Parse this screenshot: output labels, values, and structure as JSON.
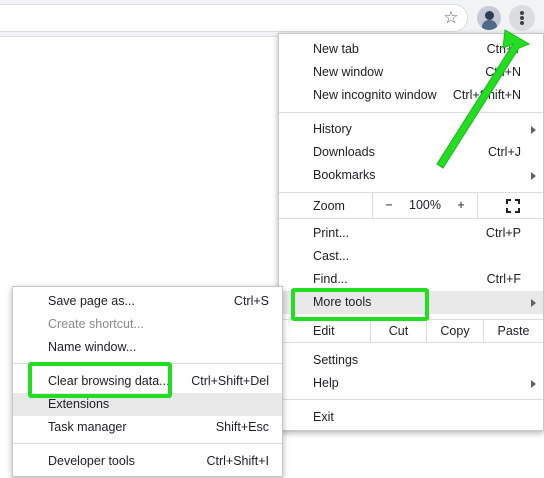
{
  "toolbar": {
    "star_icon": "star-icon",
    "avatar_icon": "avatar",
    "menu_icon": "three-dots-icon"
  },
  "main_menu": {
    "new_tab": {
      "label": "New tab",
      "shortcut": "Ctrl+T"
    },
    "new_window": {
      "label": "New window",
      "shortcut": "Ctrl+N"
    },
    "new_incognito": {
      "label": "New incognito window",
      "shortcut": "Ctrl+Shift+N"
    },
    "history": {
      "label": "History"
    },
    "downloads": {
      "label": "Downloads",
      "shortcut": "Ctrl+J"
    },
    "bookmarks": {
      "label": "Bookmarks"
    },
    "zoom": {
      "label": "Zoom",
      "minus": "−",
      "value": "100%",
      "plus": "+",
      "fullscreen_icon": "fullscreen-icon"
    },
    "print": {
      "label": "Print...",
      "shortcut": "Ctrl+P"
    },
    "cast": {
      "label": "Cast..."
    },
    "find": {
      "label": "Find...",
      "shortcut": "Ctrl+F"
    },
    "more_tools": {
      "label": "More tools"
    },
    "edit": {
      "label": "Edit",
      "cut": "Cut",
      "copy": "Copy",
      "paste": "Paste"
    },
    "settings": {
      "label": "Settings"
    },
    "help": {
      "label": "Help"
    },
    "exit": {
      "label": "Exit"
    }
  },
  "more_tools_menu": {
    "save_page": {
      "label": "Save page as...",
      "shortcut": "Ctrl+S"
    },
    "create_shortcut": {
      "label": "Create shortcut..."
    },
    "name_window": {
      "label": "Name window..."
    },
    "clear_browsing": {
      "label": "Clear browsing data...",
      "shortcut": "Ctrl+Shift+Del"
    },
    "extensions": {
      "label": "Extensions"
    },
    "task_manager": {
      "label": "Task manager",
      "shortcut": "Shift+Esc"
    },
    "developer_tools": {
      "label": "Developer tools",
      "shortcut": "Ctrl+Shift+I"
    }
  },
  "annotation": {
    "color": "#22dd22"
  }
}
